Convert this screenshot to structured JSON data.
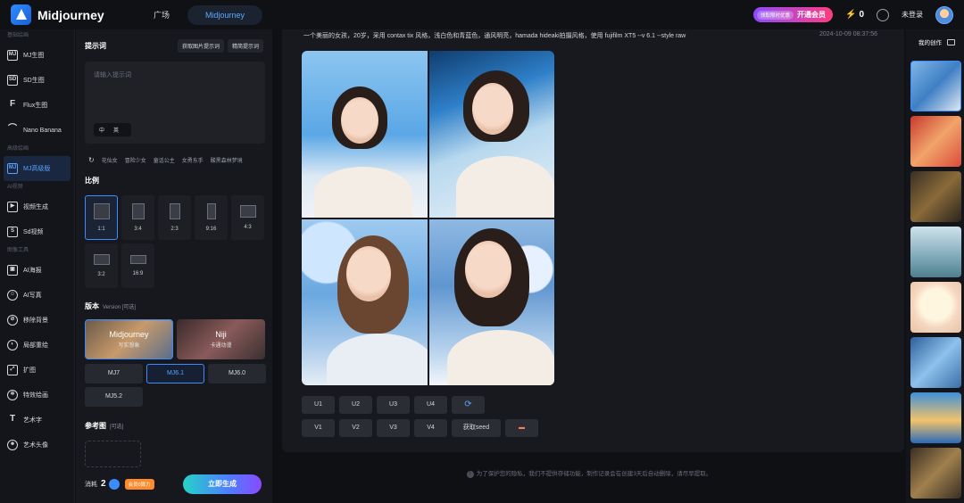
{
  "app": {
    "name": "Midjourney"
  },
  "nav": {
    "tabs": [
      "广场",
      "Midjourney"
    ],
    "active": 1
  },
  "topbar": {
    "promo_tag": "领取限时优惠",
    "promo_join": "开通会员",
    "points": "0",
    "login": "未登录"
  },
  "sidebar": {
    "sections": [
      {
        "title": "基础绘画",
        "items": [
          {
            "label": "MJ生图",
            "icon": "mj-icon"
          },
          {
            "label": "SD生图",
            "icon": "sd-icon"
          },
          {
            "label": "Flux生图",
            "icon": "flux-icon"
          },
          {
            "label": "Nano Banana",
            "icon": "banana-icon"
          }
        ]
      },
      {
        "title": "高级绘画",
        "items": [
          {
            "label": "MJ高级版",
            "icon": "mj-pro-icon",
            "active": true
          }
        ]
      },
      {
        "title": "AI视频",
        "items": [
          {
            "label": "视频生成",
            "icon": "video-icon"
          },
          {
            "label": "Sd视频",
            "icon": "sd-video-icon"
          }
        ]
      },
      {
        "title": "图像工具",
        "items": [
          {
            "label": "AI海报",
            "icon": "poster-icon"
          },
          {
            "label": "AI写真",
            "icon": "portrait-icon"
          },
          {
            "label": "移除背景",
            "icon": "remove-bg-icon"
          },
          {
            "label": "局部重绘",
            "icon": "inpaint-icon"
          },
          {
            "label": "扩图",
            "icon": "expand-icon"
          },
          {
            "label": "特效绘画",
            "icon": "effect-icon"
          },
          {
            "label": "艺术字",
            "icon": "art-text-icon"
          },
          {
            "label": "艺术头像",
            "icon": "art-avatar-icon"
          }
        ]
      }
    ]
  },
  "panel": {
    "prompt_title": "提示词",
    "get_prompt_btn": "获取图片提示词",
    "refine_prompt_btn": "精简提示词",
    "prompt_placeholder": "请输入提示词",
    "lang_zh": "中",
    "lang_en": "英",
    "suggestions": [
      "花仙女",
      "冒险少女",
      "童话公主",
      "女勇东手",
      "酸黑森林梦境"
    ],
    "ratio_title": "比例",
    "ratios": [
      "1:1",
      "3:4",
      "2:3",
      "9:16",
      "4:3",
      "3:2",
      "16:9"
    ],
    "ratio_active": "1:1",
    "version_title": "版本",
    "version_sub": "Version [可选]",
    "version_cards": [
      {
        "title": "Midjourney",
        "sub": "写实想象"
      },
      {
        "title": "Niji",
        "sub": "卡通动漫"
      }
    ],
    "version_btns": [
      "MJ7",
      "MJ6.1",
      "MJ6.0",
      "MJ5.2"
    ],
    "version_active": "MJ6.1",
    "ref_title": "参考图",
    "ref_sub": "[可选]",
    "cost_label": "消耗",
    "cost_value": "2",
    "vip_tag": "会员0算力",
    "generate_btn": "立即生成"
  },
  "main": {
    "prompt": "一个美丽的女孩，20岁，采用 contax tix 风格，浅白色和青蓝色，通风明亮，hamada hideaki拍摄风格，使用 fujifilm XT5 --v 6.1 --style raw",
    "date": "2024-10-09 08:37:56",
    "upscale_btns": [
      "U1",
      "U2",
      "U3",
      "U4"
    ],
    "variation_btns": [
      "V1",
      "V2",
      "V3",
      "V4"
    ],
    "seed_btn": "获取seed",
    "notice": "为了保护您的隐私，我们不提供存储功能，制作记录会在创建3天后自动删除，请尽早提取。"
  },
  "rightbar": {
    "title": "我的创作"
  }
}
